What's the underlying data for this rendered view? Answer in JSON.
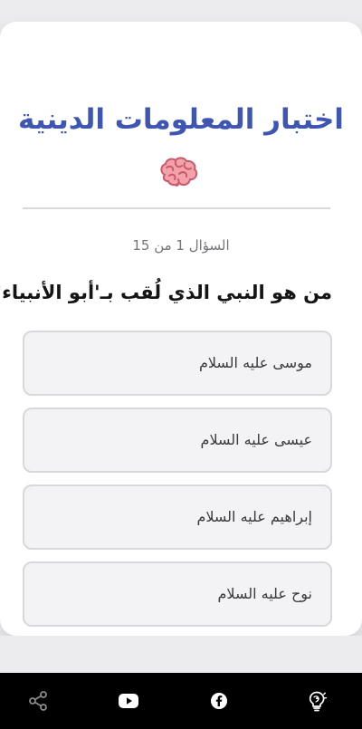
{
  "quiz": {
    "title": "اختبار المعلومات الدينية",
    "counter": "السؤال 1 من 15",
    "question": "من هو النبي الذي لُقب بـ'أبو الأنبياء'؟",
    "options": [
      "موسى عليه السلام",
      "عيسى عليه السلام",
      "إبراهيم عليه السلام",
      "نوح عليه السلام"
    ]
  },
  "icons": {
    "brain": "brain-emoji",
    "nav": [
      "share-icon",
      "youtube-icon",
      "facebook-icon",
      "idea-bulb-icon"
    ]
  },
  "colors": {
    "title": "#3e56b2",
    "background": "#ececee",
    "card": "#ffffff",
    "option_background": "#f3f3f5",
    "option_border": "#d8d8dc",
    "navigation_background": "#000000"
  }
}
